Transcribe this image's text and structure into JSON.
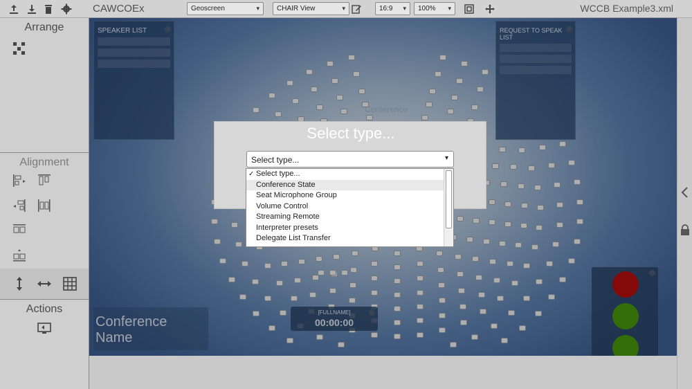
{
  "toolbar": {
    "app_title": "CAWCOEx",
    "layout_select": "Geoscreen",
    "view_select": "CHAIR View",
    "aspect_select": "16:9",
    "zoom_select": "100%",
    "file_name": "WCCB Example3.xml"
  },
  "sidebar": {
    "arrange_title": "Arrange",
    "alignment_title": "Alignment",
    "actions_title": "Actions"
  },
  "canvas": {
    "speaker_list_title": "SPEAKER LIST",
    "request_list_title": "REQUEST TO SPEAK LIST",
    "conference_label": "Conference",
    "conference_name": "Conference Name",
    "timer_name": "[FULLNAME]",
    "timer_value": "00:00:00",
    "traffic_colors": {
      "red": "#b80f0f",
      "green_1": "#49990c",
      "green_2": "#49990c"
    }
  },
  "modal": {
    "title": "Select type...",
    "select_value": "Select type...",
    "options": [
      {
        "label": "Select type...",
        "selected": true
      },
      {
        "label": "Conference State",
        "highlighted": true
      },
      {
        "label": "Seat Microphone Group"
      },
      {
        "label": "Volume Control"
      },
      {
        "label": "Streaming Remote"
      },
      {
        "label": "Interpreter presets"
      },
      {
        "label": "Delegate List Transfer"
      }
    ]
  },
  "icons": {
    "toolbar": [
      "upload-icon",
      "download-icon",
      "trash-icon",
      "gear-icon",
      "edit-icon",
      "fit-screen-icon",
      "move-icon"
    ],
    "right": [
      "chevron-left-icon",
      "lock-icon"
    ]
  }
}
